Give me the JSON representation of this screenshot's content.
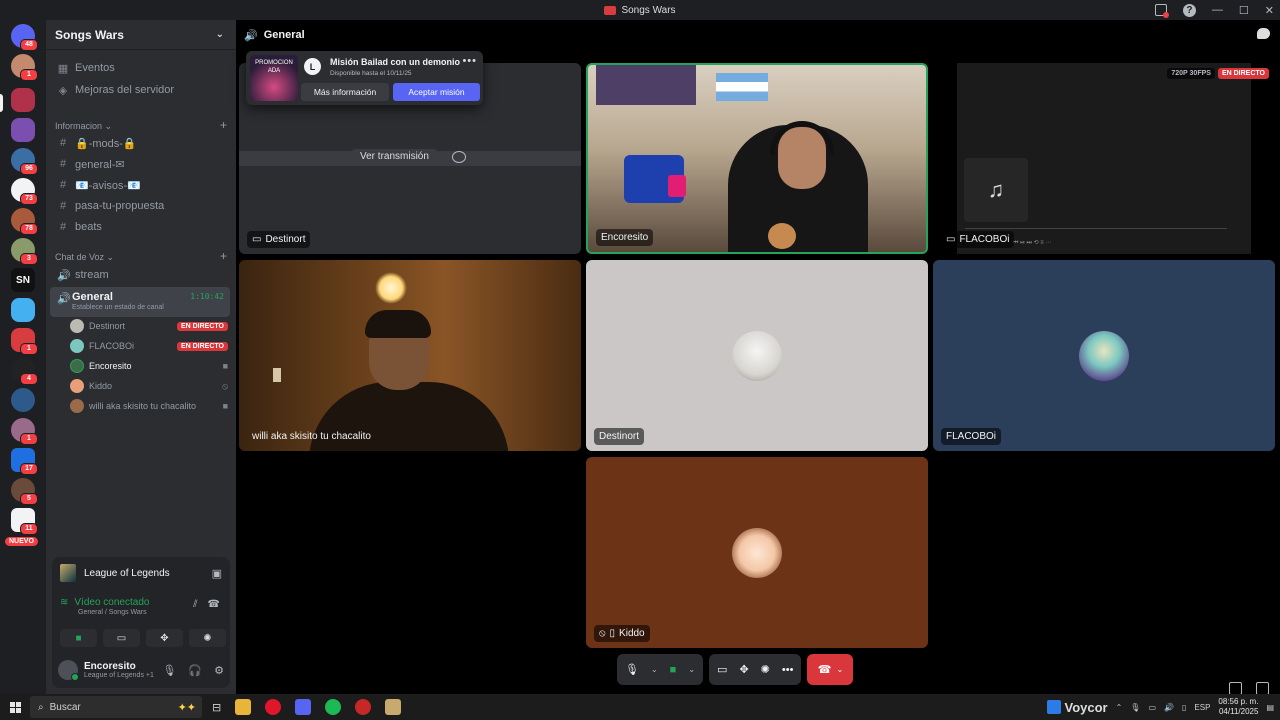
{
  "window": {
    "title": "Songs Wars"
  },
  "rail": {
    "badges": [
      "48",
      "1",
      "96",
      "73",
      "78",
      "3",
      "1",
      "4",
      "1",
      "17",
      "5",
      "11"
    ],
    "sn_label": "SN",
    "new_label": "NUEVO"
  },
  "server": {
    "name": "Songs Wars",
    "top_items": [
      {
        "icon": "calendar-icon",
        "label": "Eventos"
      },
      {
        "icon": "boost-icon",
        "label": "Mejoras del servidor"
      }
    ],
    "categories": [
      {
        "name": "Informacion",
        "channels": [
          "🔒-mods-🔒",
          "general-✉",
          "📧-avisos-📧",
          "pasa-tu-propuesta",
          "beats"
        ]
      },
      {
        "name": "Chat de Voz",
        "channels": [
          "stream",
          "General"
        ]
      }
    ],
    "active_voice": {
      "name": "General",
      "status_placeholder": "Establece un estado de canal",
      "timer": "1:10:42"
    },
    "voice_users": [
      {
        "name": "Destinort",
        "live": "EN DIRECTO"
      },
      {
        "name": "FLACOBOi",
        "live": "EN DIRECTO"
      },
      {
        "name": "Encoresito",
        "live": ""
      },
      {
        "name": "Kiddo",
        "live": ""
      },
      {
        "name": "willi aka skisito tu chacalito",
        "live": ""
      }
    ]
  },
  "activity": {
    "game": "League of Legends"
  },
  "voice_panel": {
    "status": "Vídeo conectado",
    "location": "General / Songs Wars"
  },
  "user": {
    "name": "Encoresito",
    "activity": "League of Legends +1"
  },
  "stage": {
    "channel": "General",
    "watch_stream": "Ver transmisión",
    "quality": "720P 30FPS",
    "live": "EN DIRECTO",
    "tiles": {
      "destinort_stream": "Destinort",
      "encoresito": "Encoresito",
      "flacoboi_stream": "FLACOBOi",
      "willi": "willi aka skisito tu chacalito",
      "destinort": "Destinort",
      "flacoboi": "FLACOBOi",
      "kiddo": "Kiddo"
    }
  },
  "popup": {
    "promo_label": "PROMOCION ADA",
    "title": "Misión Bailad con un demonio",
    "subtitle": "Disponible hasta el 10/11/25",
    "more_info": "Más información",
    "accept": "Aceptar misión"
  },
  "taskbar": {
    "search_placeholder": "Buscar",
    "tray_app": "Voycor",
    "lang": "ESP",
    "time": "08:56 p. m.",
    "date": "04/11/2025"
  },
  "colors": {
    "accent": "#5865f2",
    "live": "#da373c",
    "online": "#23a559"
  }
}
